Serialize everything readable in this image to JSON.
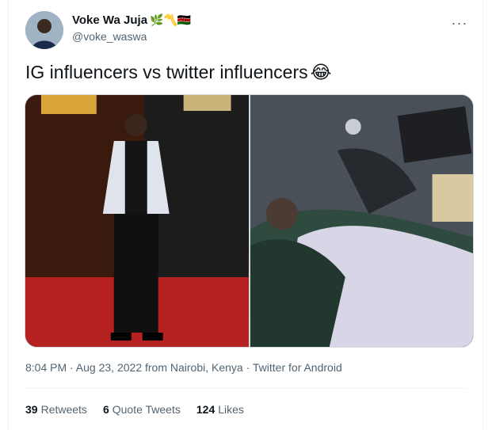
{
  "user": {
    "display_name": "Voke Wa Juja",
    "name_emojis": "🌿〽️🇰🇪",
    "handle": "@voke_waswa"
  },
  "tweet": {
    "text": "IG influencers vs twitter influencers",
    "emoji": "😂"
  },
  "images": [
    {
      "kind": "photo-left"
    },
    {
      "kind": "photo-right"
    }
  ],
  "meta": {
    "line": "8:04 PM · Aug 23, 2022 from Nairobi, Kenya · Twitter for Android"
  },
  "stats": {
    "retweets_count": "39",
    "retweets_label": "Retweets",
    "quotes_count": "6",
    "quotes_label": "Quote Tweets",
    "likes_count": "124",
    "likes_label": "Likes"
  },
  "menu_icon": "more-horizontal-icon"
}
